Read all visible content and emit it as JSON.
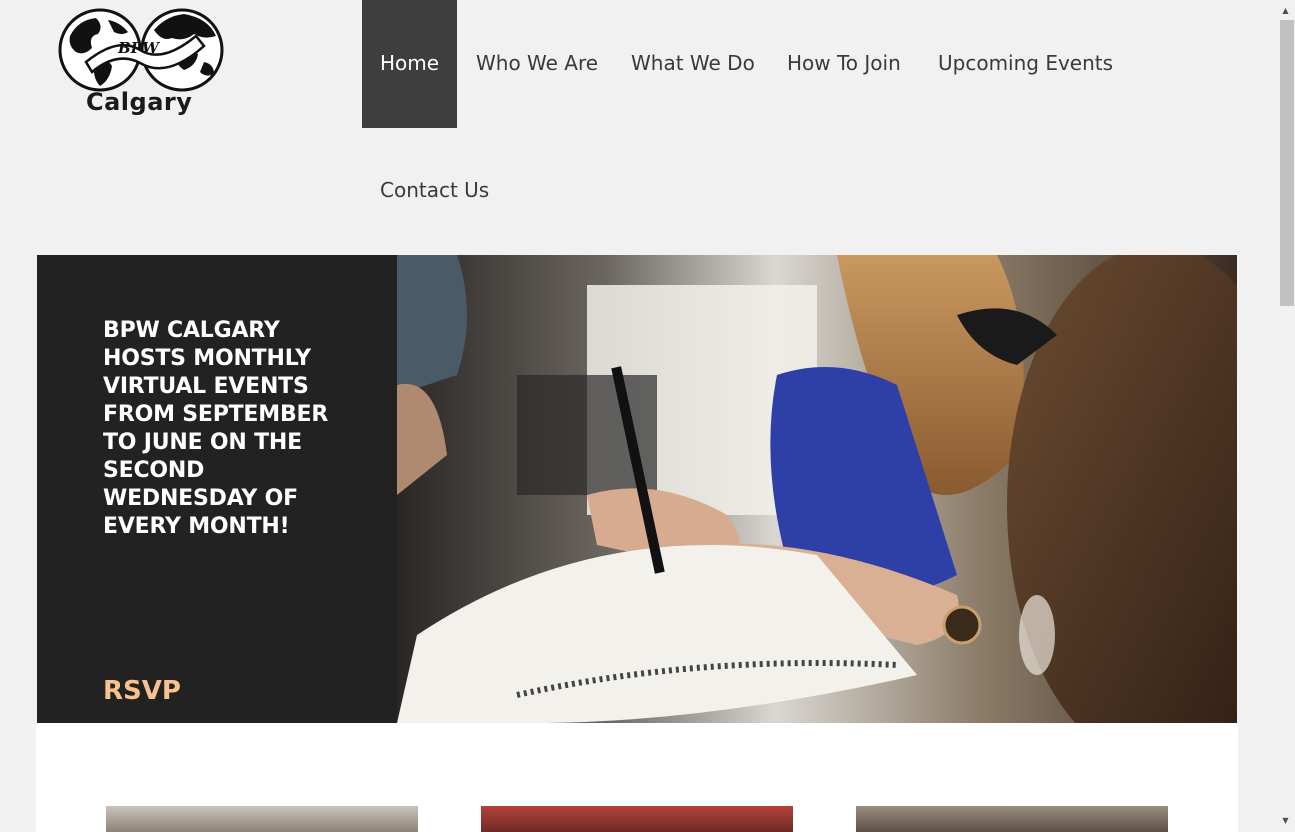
{
  "logo": {
    "text": "BPW",
    "subtitle": "Calgary"
  },
  "nav": [
    {
      "label": "Home",
      "active": true
    },
    {
      "label": "Who We Are"
    },
    {
      "label": "What We Do"
    },
    {
      "label": "How To Join"
    },
    {
      "label": "Upcoming Events"
    },
    {
      "label": "Contact Us"
    }
  ],
  "hero": {
    "headline": "BPW CALGARY HOSTS MONTHLY VIRTUAL EVENTS FROM SEPTEMBER TO JUNE ON THE SECOND WEDNESDAY OF EVERY MONTH!",
    "cta": "RSVP",
    "accent_color": "#f6c38f",
    "panel_color": "#222222"
  },
  "nav_active_color": "#3e3e3e",
  "icons": {
    "scroll_up": "▲",
    "scroll_down": "▼"
  }
}
